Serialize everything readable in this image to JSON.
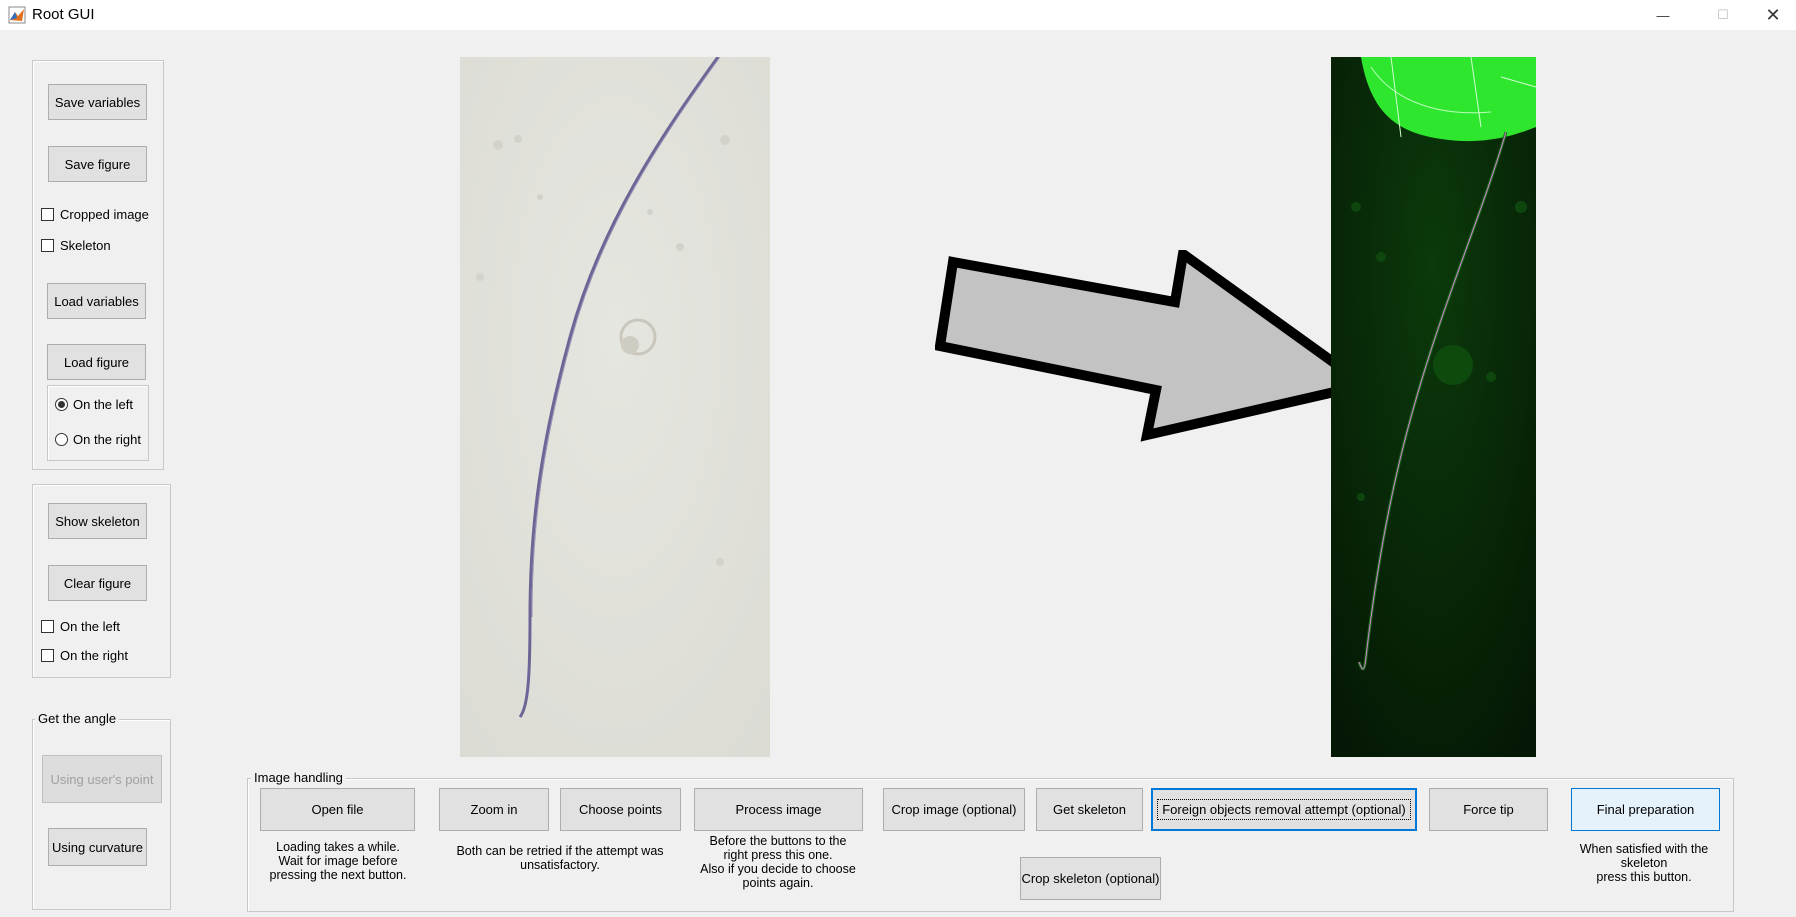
{
  "window": {
    "title": "Root GUI",
    "minimize": "—",
    "maximize": "☐",
    "close": "✕"
  },
  "save_panel": {
    "save_variables": "Save variables",
    "save_figure": "Save figure",
    "cropped_image": "Cropped image",
    "skeleton": "Skeleton",
    "load_variables": "Load variables",
    "load_figure": "Load figure",
    "on_the_left": "On the left",
    "on_the_right": "On the right",
    "selected_side": "On the left"
  },
  "skeleton_panel": {
    "show_skeleton": "Show skeleton",
    "clear_figure": "Clear figure",
    "on_the_left": "On the left",
    "on_the_right": "On the right"
  },
  "angle_panel": {
    "title": "Get the angle",
    "using_users_point": "Using user's point",
    "using_curvature": "Using curvature"
  },
  "image_handling": {
    "title": "Image handling",
    "open_file": "Open file",
    "zoom_in": "Zoom in",
    "choose_points": "Choose points",
    "process_image": "Process image",
    "crop_image": "Crop image (optional)",
    "get_skeleton": "Get skeleton",
    "foreign_objects": "Foreign objects removal attempt (optional)",
    "force_tip": "Force tip",
    "final_preparation": "Final preparation",
    "crop_skeleton": "Crop skeleton (optional)",
    "note_open": "Loading takes a while.\nWait for  image before\npressing the next button.",
    "note_zoom": "Both can be retried if the attempt was\nunsatisfactory.",
    "note_process": "Before the buttons to the\nright press this one.\nAlso if you decide to choose\npoints again.",
    "note_final": "When satisfied with the\nskeleton\npress this button."
  }
}
